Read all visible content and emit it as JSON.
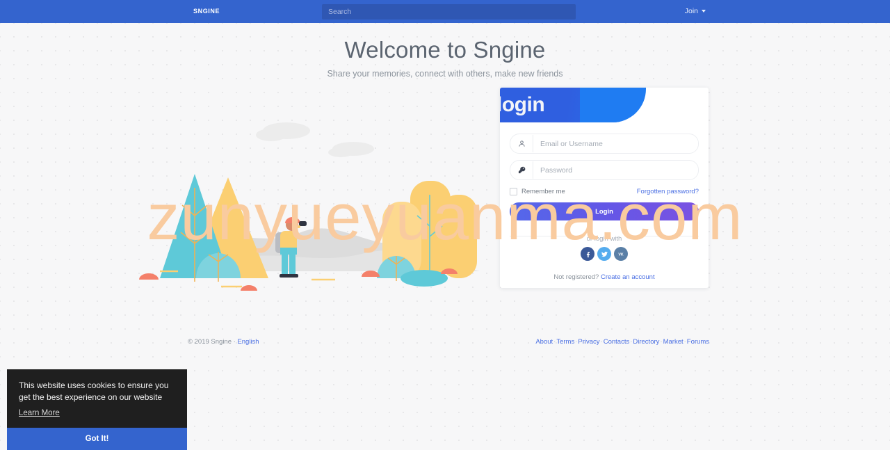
{
  "navbar": {
    "brand": "SNGINE",
    "search_placeholder": "Search",
    "search_value": "",
    "join_label": "Join"
  },
  "hero": {
    "title": "Welcome to Sngine",
    "subtitle": "Share your memories, connect with others, make new friends"
  },
  "watermark": {
    "text": "zunyueyuanma.com"
  },
  "login_card": {
    "header_title": "login",
    "username_placeholder": "Email or Username",
    "username_value": "",
    "password_placeholder": "Password",
    "password_value": "",
    "remember_label": "Remember me",
    "forgot_label": "Forgotten password?",
    "submit_label": "Login",
    "divider_label": "or login with",
    "socials": [
      {
        "name": "facebook",
        "glyph": "f",
        "color": "#3b5998"
      },
      {
        "name": "twitter",
        "glyph": "",
        "color": "#55acee"
      },
      {
        "name": "vk",
        "glyph": "vk",
        "color": "#5a7fa6"
      }
    ],
    "register_prompt": "Not registered?",
    "register_link": "Create an account"
  },
  "footer": {
    "copyright": "© 2019 Sngine ·",
    "language": "English",
    "links": [
      "About",
      "Terms",
      "Privacy",
      "Contacts",
      "Directory",
      "Market",
      "Forums"
    ]
  },
  "cookie_banner": {
    "message": "This website uses cookies to ensure you get the best experience on our website",
    "learn_more": "Learn More",
    "accept_label": "Got It!"
  },
  "colors": {
    "navbar": "#3464ce",
    "accent_link": "#4a6fe3",
    "login_button_start": "#5468ea",
    "login_button_end": "#7b52e2",
    "watermark": "#f9cb9f",
    "cookie_bg": "#1f1f1f"
  }
}
